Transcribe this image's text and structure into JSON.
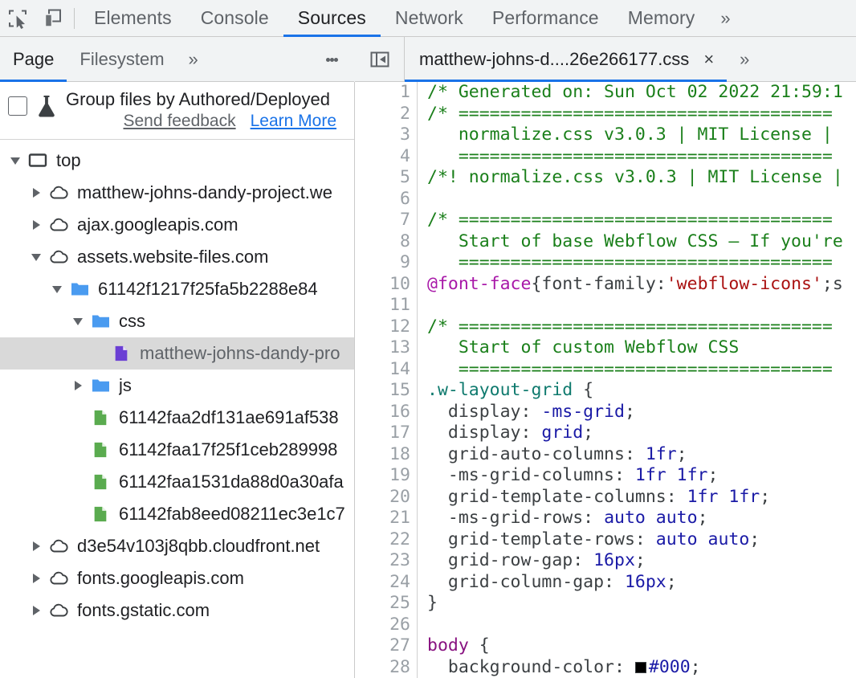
{
  "toolbar": {
    "inspect_icon": "inspect-element-icon",
    "device_icon": "device-toolbar-icon",
    "tabs": [
      {
        "label": "Elements",
        "active": false
      },
      {
        "label": "Console",
        "active": false
      },
      {
        "label": "Sources",
        "active": true
      },
      {
        "label": "Network",
        "active": false
      },
      {
        "label": "Performance",
        "active": false
      },
      {
        "label": "Memory",
        "active": false
      }
    ],
    "more_tabs": "»"
  },
  "navigator": {
    "tabs": [
      {
        "label": "Page",
        "active": true
      },
      {
        "label": "Filesystem",
        "active": false
      },
      {
        "label": "»",
        "active": false
      }
    ],
    "kebab": "more-options-icon",
    "experiment": {
      "title": "Group files by Authored/Deployed",
      "send_feedback": "Send feedback",
      "learn_more": "Learn More",
      "checked": false
    },
    "tree": [
      {
        "label": "top",
        "depth": 0,
        "icon": "frame-icon",
        "arrow": "down",
        "selected": false
      },
      {
        "label": "matthew-johns-dandy-project.we",
        "depth": 1,
        "icon": "cloud-icon",
        "arrow": "right",
        "selected": false
      },
      {
        "label": "ajax.googleapis.com",
        "depth": 1,
        "icon": "cloud-icon",
        "arrow": "right",
        "selected": false
      },
      {
        "label": "assets.website-files.com",
        "depth": 1,
        "icon": "cloud-icon",
        "arrow": "down",
        "selected": false
      },
      {
        "label": "61142f1217f25fa5b2288e84",
        "depth": 2,
        "icon": "folder-icon",
        "arrow": "down",
        "selected": false
      },
      {
        "label": "css",
        "depth": 3,
        "icon": "folder-icon",
        "arrow": "down",
        "selected": false
      },
      {
        "label": "matthew-johns-dandy-pro",
        "depth": 4,
        "icon": "css-file-icon",
        "arrow": "none",
        "selected": true
      },
      {
        "label": "js",
        "depth": 3,
        "icon": "folder-icon",
        "arrow": "right",
        "selected": false
      },
      {
        "label": "61142faa2df131ae691af538",
        "depth": 3,
        "icon": "js-file-icon",
        "arrow": "none",
        "selected": false
      },
      {
        "label": "61142faa17f25f1ceb289998",
        "depth": 3,
        "icon": "js-file-icon",
        "arrow": "none",
        "selected": false
      },
      {
        "label": "61142faa1531da88d0a30afa",
        "depth": 3,
        "icon": "js-file-icon",
        "arrow": "none",
        "selected": false
      },
      {
        "label": "61142fab8eed08211ec3e1c7",
        "depth": 3,
        "icon": "js-file-icon",
        "arrow": "none",
        "selected": false
      },
      {
        "label": "d3e54v103j8qbb.cloudfront.net",
        "depth": 1,
        "icon": "cloud-icon",
        "arrow": "right",
        "selected": false
      },
      {
        "label": "fonts.googleapis.com",
        "depth": 1,
        "icon": "cloud-icon",
        "arrow": "right",
        "selected": false
      },
      {
        "label": "fonts.gstatic.com",
        "depth": 1,
        "icon": "cloud-icon",
        "arrow": "right",
        "selected": false
      }
    ]
  },
  "editor": {
    "collapse_icon": "collapse-sidebar-icon",
    "tab_title": "matthew-johns-d....26e266177.css",
    "close_label": "×",
    "more_label": "»",
    "lines": [
      {
        "n": 1,
        "tokens": [
          {
            "t": "/* Generated on: Sun Oct 02 2022 21:59:1",
            "c": "c-com"
          }
        ]
      },
      {
        "n": 2,
        "tokens": [
          {
            "t": "/* ====================================",
            "c": "c-com"
          }
        ]
      },
      {
        "n": 3,
        "tokens": [
          {
            "t": "   normalize.css v3.0.3 | MIT License | ",
            "c": "c-com"
          }
        ]
      },
      {
        "n": 4,
        "tokens": [
          {
            "t": "   ====================================",
            "c": "c-com"
          }
        ]
      },
      {
        "n": 5,
        "tokens": [
          {
            "t": "/*! normalize.css v3.0.3 | MIT License |",
            "c": "c-com"
          }
        ]
      },
      {
        "n": 6,
        "tokens": []
      },
      {
        "n": 7,
        "tokens": [
          {
            "t": "/* ====================================",
            "c": "c-com"
          }
        ]
      },
      {
        "n": 8,
        "tokens": [
          {
            "t": "   Start of base Webflow CSS – If you're",
            "c": "c-com"
          }
        ]
      },
      {
        "n": 9,
        "tokens": [
          {
            "t": "   ====================================",
            "c": "c-com"
          }
        ]
      },
      {
        "n": 10,
        "tokens": [
          {
            "t": "@font-face",
            "c": "c-atr"
          },
          {
            "t": "{font-family:",
            "c": "c-plain"
          },
          {
            "t": "'webflow-icons'",
            "c": "c-str"
          },
          {
            "t": ";s",
            "c": "c-plain"
          }
        ]
      },
      {
        "n": 11,
        "tokens": []
      },
      {
        "n": 12,
        "tokens": [
          {
            "t": "/* ====================================",
            "c": "c-com"
          }
        ]
      },
      {
        "n": 13,
        "tokens": [
          {
            "t": "   Start of custom Webflow CSS",
            "c": "c-com"
          }
        ]
      },
      {
        "n": 14,
        "tokens": [
          {
            "t": "   ====================================",
            "c": "c-com"
          }
        ]
      },
      {
        "n": 15,
        "tokens": [
          {
            "t": ".w-layout-grid",
            "c": "c-sel"
          },
          {
            "t": " {",
            "c": "c-plain"
          }
        ]
      },
      {
        "n": 16,
        "tokens": [
          {
            "t": "  display: ",
            "c": "c-prop"
          },
          {
            "t": "-ms-grid",
            "c": "c-val"
          },
          {
            "t": ";",
            "c": "c-plain"
          }
        ]
      },
      {
        "n": 17,
        "tokens": [
          {
            "t": "  display: ",
            "c": "c-prop"
          },
          {
            "t": "grid",
            "c": "c-val"
          },
          {
            "t": ";",
            "c": "c-plain"
          }
        ]
      },
      {
        "n": 18,
        "tokens": [
          {
            "t": "  grid-auto-columns: ",
            "c": "c-prop"
          },
          {
            "t": "1fr",
            "c": "c-val"
          },
          {
            "t": ";",
            "c": "c-plain"
          }
        ]
      },
      {
        "n": 19,
        "tokens": [
          {
            "t": "  -ms-grid-columns: ",
            "c": "c-prop"
          },
          {
            "t": "1fr 1fr",
            "c": "c-val"
          },
          {
            "t": ";",
            "c": "c-plain"
          }
        ]
      },
      {
        "n": 20,
        "tokens": [
          {
            "t": "  grid-template-columns: ",
            "c": "c-prop"
          },
          {
            "t": "1fr 1fr",
            "c": "c-val"
          },
          {
            "t": ";",
            "c": "c-plain"
          }
        ]
      },
      {
        "n": 21,
        "tokens": [
          {
            "t": "  -ms-grid-rows: ",
            "c": "c-prop"
          },
          {
            "t": "auto auto",
            "c": "c-val"
          },
          {
            "t": ";",
            "c": "c-plain"
          }
        ]
      },
      {
        "n": 22,
        "tokens": [
          {
            "t": "  grid-template-rows: ",
            "c": "c-prop"
          },
          {
            "t": "auto auto",
            "c": "c-val"
          },
          {
            "t": ";",
            "c": "c-plain"
          }
        ]
      },
      {
        "n": 23,
        "tokens": [
          {
            "t": "  grid-row-gap: ",
            "c": "c-prop"
          },
          {
            "t": "16px",
            "c": "c-val"
          },
          {
            "t": ";",
            "c": "c-plain"
          }
        ]
      },
      {
        "n": 24,
        "tokens": [
          {
            "t": "  grid-column-gap: ",
            "c": "c-prop"
          },
          {
            "t": "16px",
            "c": "c-val"
          },
          {
            "t": ";",
            "c": "c-plain"
          }
        ]
      },
      {
        "n": 25,
        "tokens": [
          {
            "t": "}",
            "c": "c-plain"
          }
        ]
      },
      {
        "n": 26,
        "tokens": []
      },
      {
        "n": 27,
        "tokens": [
          {
            "t": "body",
            "c": "c-tag"
          },
          {
            "t": " {",
            "c": "c-plain"
          }
        ]
      },
      {
        "n": 28,
        "tokens": [
          {
            "t": "  background-color: ",
            "c": "c-prop"
          },
          {
            "t": "#000",
            "c": "c-val",
            "swatch": "#000000"
          },
          {
            "t": ";",
            "c": "c-plain"
          }
        ]
      }
    ]
  },
  "colors": {
    "accent": "#1a73e8",
    "chrome_bg": "#f1f3f4",
    "selected_row": "#d9d9d9",
    "comment": "#1a7f1a",
    "atrule": "#a818a8",
    "string": "#aa1111",
    "selector": "#0f7a6e",
    "value": "#1a1aa6",
    "tag": "#881280"
  }
}
